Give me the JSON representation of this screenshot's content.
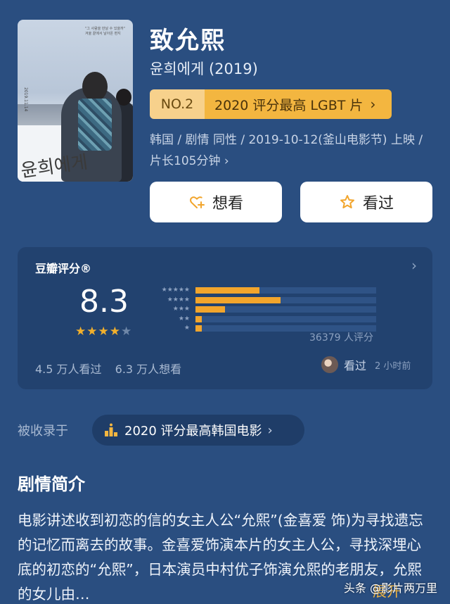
{
  "poster": {
    "calligraphy": "윤희에게",
    "date_text": "2019.11.14",
    "blurb_text": "\"그 사람을 만날 수 있을까\" 겨울 끝에서 날아온 편지"
  },
  "movie": {
    "title": "致允熙",
    "original_title": "윤희에게 (2019)"
  },
  "rank": {
    "no": "NO.2",
    "text": "2020 评分最高 LGBT 片",
    "chevron": "›"
  },
  "meta": {
    "text": "韩国 / 剧情 同性 / 2019-10-12(釜山电影节) 上映 / 片长105分钟 ›"
  },
  "actions": {
    "want_label": "想看",
    "seen_label": "看过"
  },
  "rating": {
    "title": "豆瓣评分®",
    "score": "8.3",
    "stars_on": "★★★★",
    "stars_off": "★",
    "count": "36379 人评分",
    "watched": "4.5 万人看过",
    "want": "6.3 万人想看",
    "recent_action": "看过",
    "recent_time": "2 小时前",
    "distribution": [
      {
        "stars": "★★★★★",
        "percent": 35.5
      },
      {
        "stars": "★★★★",
        "percent": 47.0
      },
      {
        "stars": "★★★",
        "percent": 16.5
      },
      {
        "stars": "★★",
        "percent": 3.5
      },
      {
        "stars": "★",
        "percent": 3.5
      }
    ]
  },
  "collection": {
    "label": "被收录于",
    "chip": "2020 评分最高韩国电影",
    "chevron": "›"
  },
  "synopsis": {
    "heading": "剧情简介",
    "body": "电影讲述收到初恋的信的女主人公“允熙”(金喜爱 饰)为寻找遗忘的记忆而离去的故事。金喜爱饰演本片的女主人公，寻找深埋心底的初恋的“允熙”，日本演员中村优子饰演允熙的老朋友，允熙的女儿由…",
    "expand": "展开"
  },
  "watermark": "头条 @影片两万里",
  "colors": {
    "background": "#2a4e80",
    "card": "#22426f",
    "accent": "#f3b640",
    "bar": "#f2a52c"
  }
}
